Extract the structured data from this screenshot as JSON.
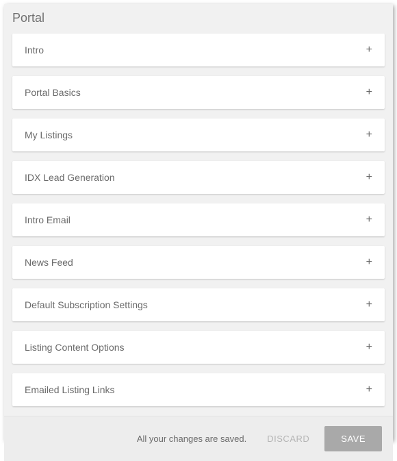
{
  "header": {
    "title": "Portal"
  },
  "sections": [
    {
      "label": "Intro"
    },
    {
      "label": "Portal Basics"
    },
    {
      "label": "My Listings"
    },
    {
      "label": "IDX Lead Generation"
    },
    {
      "label": "Intro Email"
    },
    {
      "label": "News Feed"
    },
    {
      "label": "Default Subscription Settings"
    },
    {
      "label": "Listing Content Options"
    },
    {
      "label": "Emailed Listing Links"
    }
  ],
  "footer": {
    "status": "All your changes are saved.",
    "discard_label": "Discard",
    "save_label": "Save"
  },
  "icons": {
    "plus": "+"
  }
}
